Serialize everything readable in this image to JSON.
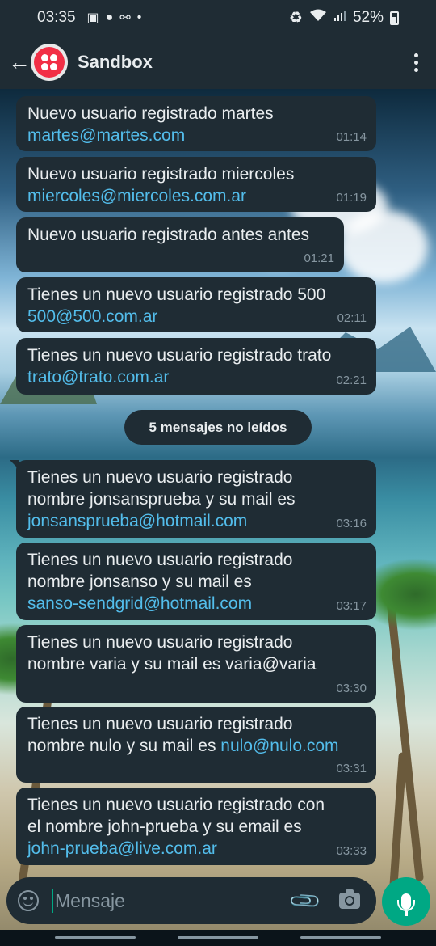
{
  "status_bar": {
    "time": "03:35",
    "battery": "52%",
    "icons": [
      "image-icon",
      "account-icon",
      "voicemail-icon",
      "dot-icon",
      "battery-saver-icon",
      "wifi-icon",
      "signal-icon",
      "battery-icon"
    ]
  },
  "header": {
    "title": "Sandbox",
    "avatar_icon": "twilio-logo-icon"
  },
  "messages": [
    {
      "text": "Nuevo usuario registrado martes",
      "link": "martes@martes.com",
      "time": "01:14"
    },
    {
      "text": "Nuevo usuario registrado miercoles",
      "link": "miercoles@miercoles.com.ar",
      "time": "01:19"
    },
    {
      "text": "Nuevo usuario registrado antes antes",
      "link": "",
      "time": "01:21"
    },
    {
      "text": "Tienes un nuevo usuario registrado 500",
      "link": "500@500.com.ar",
      "time": "02:11"
    },
    {
      "text": "Tienes un nuevo usuario registrado trato",
      "link": "trato@trato.com.ar",
      "time": "02:21"
    },
    {
      "line1": "Tienes un nuevo usuario registrado",
      "line2": "nombre jonsansprueba y su mail es",
      "link": "jonsansprueba@hotmail.com",
      "time": "03:16"
    },
    {
      "line1": "Tienes un nuevo usuario registrado",
      "line2": "nombre jonsanso y su mail es",
      "link": "sanso-sendgrid@hotmail.com",
      "time": "03:17"
    },
    {
      "line1": "Tienes un nuevo usuario registrado",
      "line2": "nombre varia y su mail es varia@varia",
      "time": "03:30"
    },
    {
      "line1": "Tienes un nuevo usuario registrado",
      "line2": "nombre nulo y su mail es ",
      "link": "nulo@nulo.com",
      "time": "03:31"
    },
    {
      "line1": "Tienes un nuevo usuario registrado con",
      "line2": "el nombre john-prueba y su email es",
      "link": "john-prueba@live.com.ar",
      "time": "03:33"
    }
  ],
  "unread_divider": "5 mensajes no leídos",
  "input": {
    "placeholder": "Mensaje",
    "value": ""
  },
  "colors": {
    "bubble": "#1f2c34",
    "link": "#53bdeb",
    "accent": "#00a884",
    "timestamp": "#8696a0"
  }
}
